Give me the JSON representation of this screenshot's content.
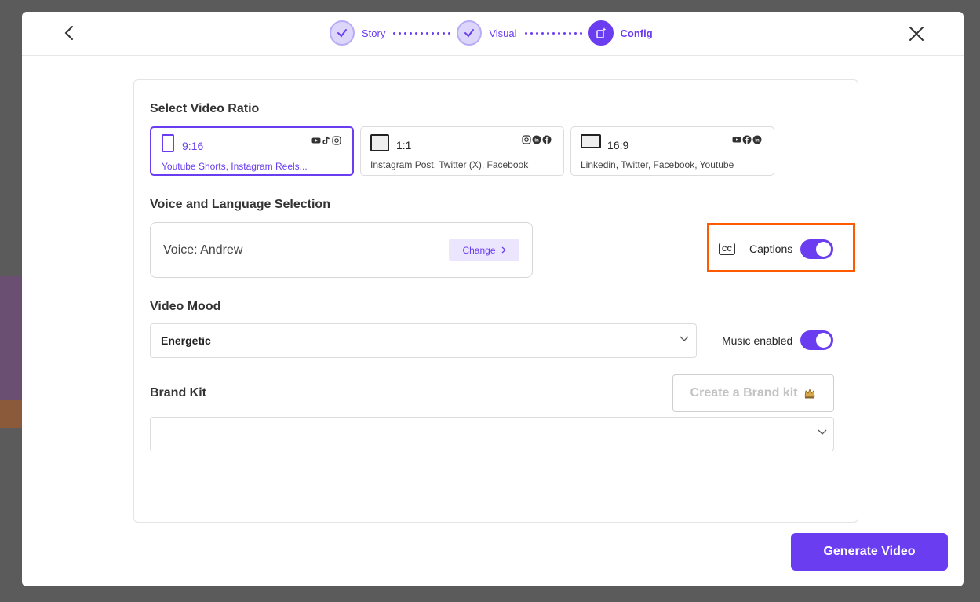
{
  "stepper": {
    "steps": [
      {
        "label": "Story",
        "state": "done"
      },
      {
        "label": "Visual",
        "state": "done"
      },
      {
        "label": "Config",
        "state": "active"
      }
    ]
  },
  "ratio_section": {
    "title": "Select Video Ratio",
    "options": [
      {
        "label": "9:16",
        "description": "Youtube Shorts, Instagram Reels...",
        "selected": true,
        "icons": [
          "youtube-icon",
          "tiktok-icon",
          "instagram-icon"
        ]
      },
      {
        "label": "1:1",
        "description": "Instagram Post, Twitter (X), Facebook",
        "selected": false,
        "icons": [
          "instagram-icon",
          "linkedin-icon",
          "facebook-icon"
        ]
      },
      {
        "label": "16:9",
        "description": "Linkedin, Twitter, Facebook, Youtube",
        "selected": false,
        "icons": [
          "youtube-icon",
          "facebook-icon",
          "linkedin-icon"
        ]
      }
    ]
  },
  "voice_section": {
    "title": "Voice and Language Selection",
    "voice_text": "Voice: Andrew",
    "change_label": "Change",
    "captions_icon_text": "CC",
    "captions_label": "Captions",
    "captions_enabled": true
  },
  "mood_section": {
    "title": "Video Mood",
    "selected_mood": "Energetic",
    "music_label": "Music enabled",
    "music_enabled": true
  },
  "brand_section": {
    "title": "Brand Kit",
    "create_label": "Create a Brand kit",
    "selected_brand": ""
  },
  "footer": {
    "generate_label": "Generate Video"
  },
  "colors": {
    "accent": "#6a3df0",
    "highlight": "#ff5a00"
  }
}
